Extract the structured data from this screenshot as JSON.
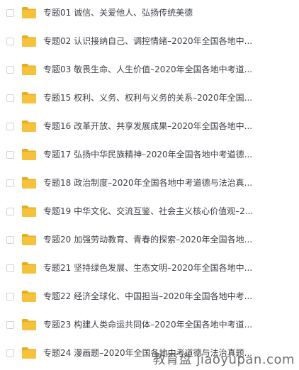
{
  "file_list": {
    "items": [
      {
        "name": "专题01 诚信、关爱他人、弘扬传统美德",
        "icon": "folder-icon",
        "checked": false
      },
      {
        "name": "专题02 认识接纳自己、调控情绪–2020年全国各地中...",
        "icon": "folder-icon",
        "checked": false
      },
      {
        "name": "专题03 敬畏生命、人生价值–2020年全国各地中考道...",
        "icon": "folder-icon",
        "checked": false
      },
      {
        "name": "专题15 权利、义务、权利与义务的关系–2020年全国...",
        "icon": "folder-icon",
        "checked": false
      },
      {
        "name": "专题16 改革开放、共享发展成果–2020年全国各地中...",
        "icon": "folder-icon",
        "checked": false
      },
      {
        "name": "专题17 弘扬中华民族精神–2020年全国各地中考道德...",
        "icon": "folder-icon",
        "checked": false
      },
      {
        "name": "专题18 政治制度–2020年全国各地中考道德与法治真...",
        "icon": "folder-icon",
        "checked": false
      },
      {
        "name": "专题19 中华文化、交流互鉴、社会主义核心价值观–2...",
        "icon": "folder-icon",
        "checked": false
      },
      {
        "name": "专题20 加强劳动教育、青春的探索–2020年全国各地...",
        "icon": "folder-icon",
        "checked": false
      },
      {
        "name": "专题21 坚持绿色发展、生态文明–2020年全国各地中...",
        "icon": "folder-icon",
        "checked": false
      },
      {
        "name": "专题22 经济全球化、中国担当–2020年全国各地中考...",
        "icon": "folder-icon",
        "checked": false
      },
      {
        "name": "专题23 构建人类命运共同体–2020年全国各地中考道...",
        "icon": "folder-icon",
        "checked": false
      },
      {
        "name": "专题24 漫画题–2020年全国各地中考道德与法治真题...",
        "icon": "folder-icon",
        "checked": false
      }
    ]
  },
  "colors": {
    "folder_body": "#f5c23a",
    "folder_back": "#e9ad1c",
    "text": "#3d4047",
    "checkbox_border": "#cfd3d9"
  },
  "watermark": "教育盘 jiaoyupan.com"
}
